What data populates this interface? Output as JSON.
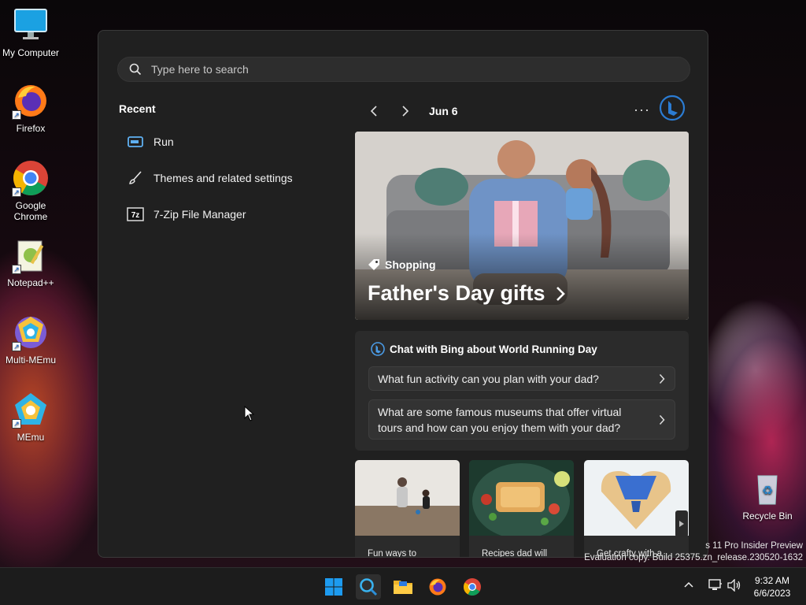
{
  "desktop": {
    "icons": [
      {
        "label": "My Computer",
        "icon": "monitor-icon"
      },
      {
        "label": "Firefox",
        "icon": "firefox-icon"
      },
      {
        "label": "Google Chrome",
        "icon": "chrome-icon"
      },
      {
        "label": "Notepad++",
        "icon": "notepadpp-icon"
      },
      {
        "label": "Multi-MEmu",
        "icon": "multimemu-icon"
      },
      {
        "label": "MEmu",
        "icon": "memu-icon"
      },
      {
        "label": "Recycle Bin",
        "icon": "recycle-bin-icon"
      }
    ]
  },
  "search": {
    "placeholder": "Type here to search"
  },
  "recent": {
    "title": "Recent",
    "items": [
      {
        "label": "Run",
        "icon": "run-icon"
      },
      {
        "label": "Themes and related settings",
        "icon": "brush-icon"
      },
      {
        "label": "7-Zip File Manager",
        "icon": "7zip-icon"
      }
    ]
  },
  "feed": {
    "date": "Jun 6",
    "more": "···",
    "hero": {
      "category": "Shopping",
      "title": "Father's Day gifts"
    },
    "chat": {
      "heading": "Chat with Bing about World Running Day",
      "questions": [
        "What fun activity can you plan with your dad?",
        "What are some famous museums that offer virtual tours and how can you enjoy them with your dad?"
      ]
    },
    "cards": [
      {
        "caption": "Fun ways to"
      },
      {
        "caption": "Recipes dad will"
      },
      {
        "caption": "Get crafty with a"
      }
    ]
  },
  "watermark": {
    "line1": "s 11 Pro Insider Preview",
    "line2": "Evaluation copy. Build 25375.zn_release.230520-1632"
  },
  "taskbar": {
    "time": "9:32 AM",
    "date": "6/6/2023"
  },
  "colors": {
    "panel": "#202020",
    "accent_bing": "#2b7cd3",
    "start_blue": "#1d9bf0"
  }
}
